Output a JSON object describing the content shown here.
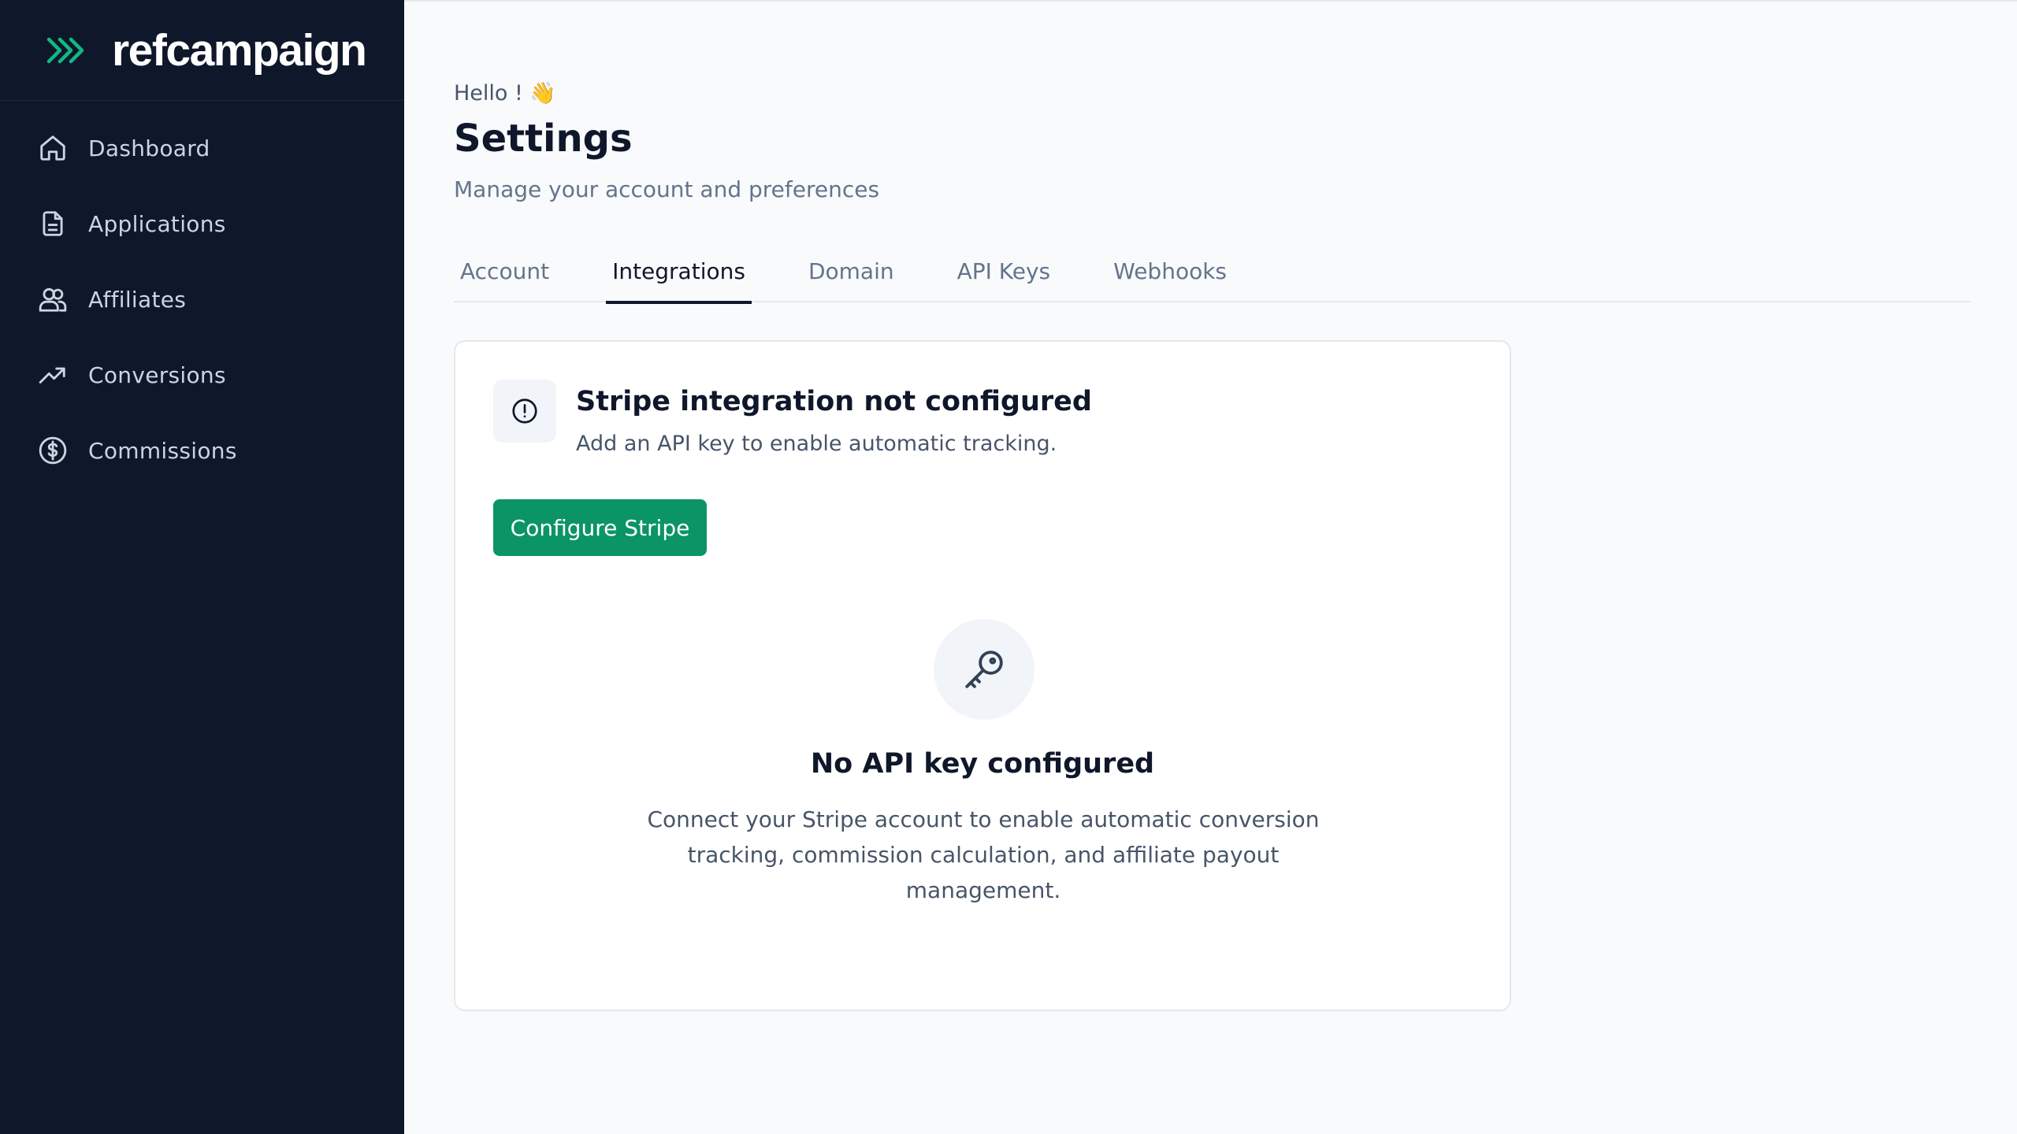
{
  "brand": {
    "name": "refcampaign",
    "accent_color": "#10b981"
  },
  "sidebar": {
    "items": [
      {
        "label": "Dashboard",
        "icon": "home-icon"
      },
      {
        "label": "Applications",
        "icon": "file-icon"
      },
      {
        "label": "Affiliates",
        "icon": "users-icon"
      },
      {
        "label": "Conversions",
        "icon": "trending-up-icon"
      },
      {
        "label": "Commissions",
        "icon": "dollar-circle-icon"
      }
    ]
  },
  "header": {
    "greeting": "Hello ! 👋",
    "title": "Settings",
    "subtitle": "Manage your account and preferences"
  },
  "tabs": [
    {
      "label": "Account",
      "active": false
    },
    {
      "label": "Integrations",
      "active": true
    },
    {
      "label": "Domain",
      "active": false
    },
    {
      "label": "API Keys",
      "active": false
    },
    {
      "label": "Webhooks",
      "active": false
    }
  ],
  "integration": {
    "alert_icon": "alert-circle-icon",
    "alert_title": "Stripe integration not configured",
    "alert_description": "Add an API key to enable automatic tracking.",
    "configure_button": "Configure Stripe",
    "button_color": "#0b9466",
    "empty_icon": "key-icon",
    "empty_title": "No API key configured",
    "empty_description": "Connect your Stripe account to enable automatic conversion tracking, commission calculation, and affiliate payout management."
  }
}
